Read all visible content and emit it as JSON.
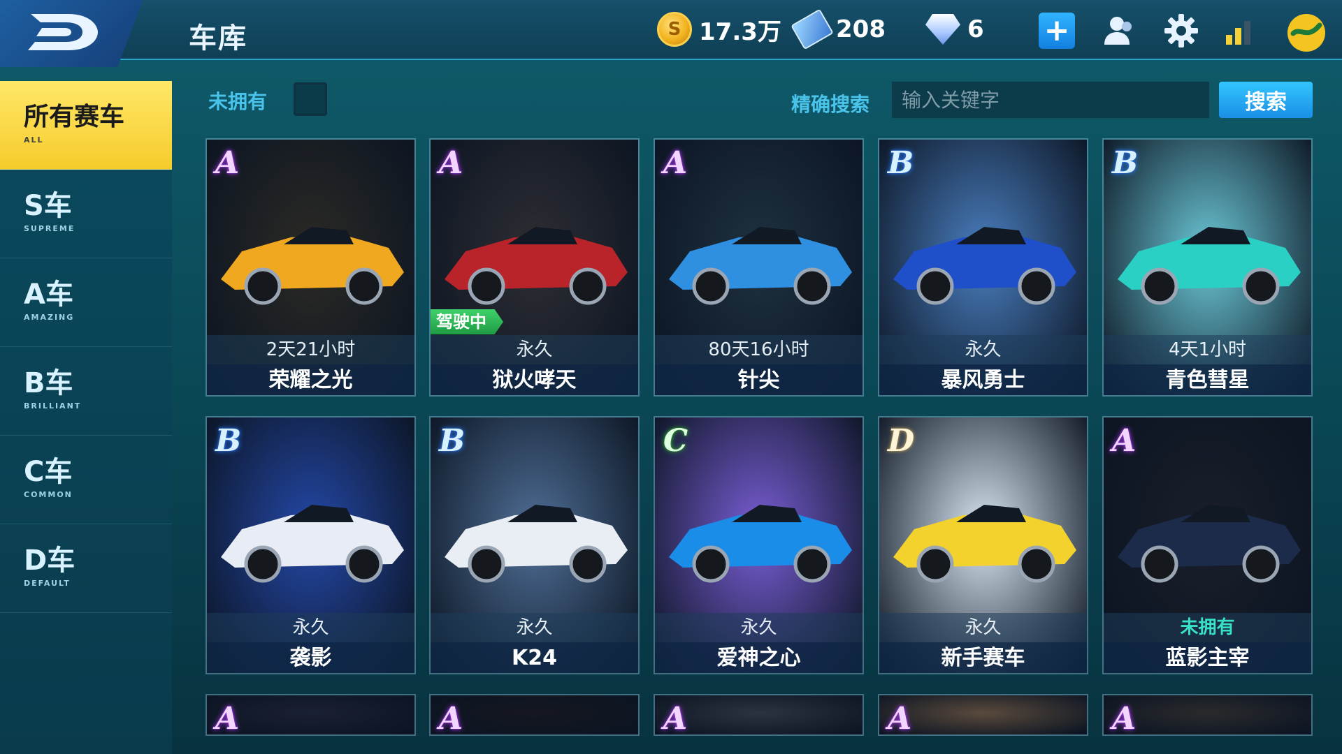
{
  "header": {
    "title": "车库",
    "coins": "17.3万",
    "tickets": "208",
    "diamonds": "6"
  },
  "sidebar": {
    "items": [
      {
        "label": "所有赛车",
        "sub": "ALL",
        "active": true
      },
      {
        "label": "S车",
        "sub": "SUPREME",
        "active": false
      },
      {
        "label": "A车",
        "sub": "AMAZING",
        "active": false
      },
      {
        "label": "B车",
        "sub": "BRILLIANT",
        "active": false
      },
      {
        "label": "C车",
        "sub": "COMMON",
        "active": false
      },
      {
        "label": "D车",
        "sub": "DEFAULT",
        "active": false
      }
    ]
  },
  "filter": {
    "unowned_label": "未拥有",
    "search_label": "精确搜索",
    "search_placeholder": "输入关键字",
    "search_button": "搜索"
  },
  "cards": [
    {
      "tier": "A",
      "duration": "2天21小时",
      "name": "荣耀之光",
      "color": "#f0a820",
      "bg": "#2b2a25"
    },
    {
      "tier": "A",
      "duration": "永久",
      "name": "狱火哮天",
      "color": "#b8242a",
      "bg": "#2e2e33",
      "driving": "驾驶中"
    },
    {
      "tier": "A",
      "duration": "80天16小时",
      "name": "针尖",
      "color": "#2f8fe0",
      "bg": "#1f3140"
    },
    {
      "tier": "B",
      "duration": "永久",
      "name": "暴风勇士",
      "color": "#1f4fc9",
      "bg": "#4a7fc0"
    },
    {
      "tier": "B",
      "duration": "4天1小时",
      "name": "青色彗星",
      "color": "#2bd0c4",
      "bg": "#6cc8d7"
    },
    {
      "tier": "B",
      "duration": "永久",
      "name": "袭影",
      "color": "#e8ecf5",
      "bg": "#2448a8"
    },
    {
      "tier": "B",
      "duration": "永久",
      "name": "K24",
      "color": "#e9eef4",
      "bg": "#4f6f96"
    },
    {
      "tier": "C",
      "duration": "永久",
      "name": "爱神之心",
      "color": "#1a8de8",
      "bg": "#7a5ed6"
    },
    {
      "tier": "D",
      "duration": "永久",
      "name": "新手赛车",
      "color": "#f3d22e",
      "bg": "#d9e7f3"
    },
    {
      "tier": "A",
      "duration": "未拥有",
      "name": "蓝影主宰",
      "color": "#1c2b4a",
      "bg": "#1a1f2a",
      "unowned": true
    },
    {
      "tier": "A",
      "bg": "#1a2033"
    },
    {
      "tier": "A",
      "bg": "#151720"
    },
    {
      "tier": "A",
      "bg": "#2c3340"
    },
    {
      "tier": "A",
      "bg": "#5a4a3c"
    },
    {
      "tier": "A",
      "bg": "#2a2a2c"
    }
  ]
}
